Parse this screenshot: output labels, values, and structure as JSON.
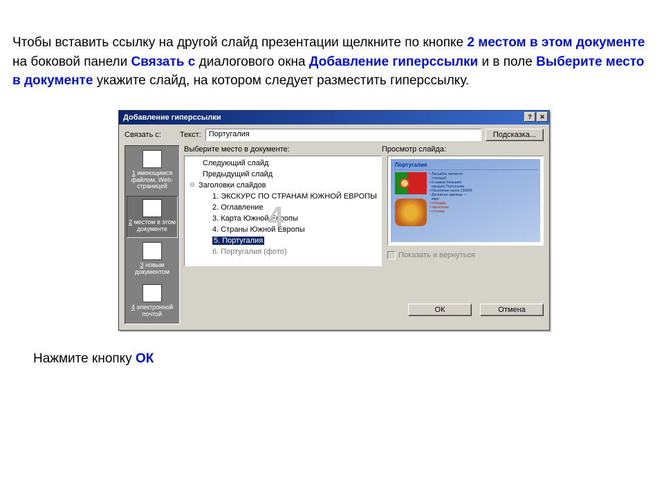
{
  "instr": {
    "t1": "Чтобы вставить ссылку на другой слайд презентации щелкните по кнопке ",
    "h1": "2 местом в этом документе",
    "t2": " на боковой панели ",
    "h2": "Связать с",
    "t3": " диалогового окна ",
    "h3": "Добавление гиперссылки",
    "t4": " и в поле ",
    "h4": "Выберите место в документе",
    "t5": " укажите слайд, на котором следует разместить гиперссылку."
  },
  "bottom": {
    "t": "Нажмите кнопку ",
    "ok": "ОК"
  },
  "dlg": {
    "title": "Добавление гиперссылки",
    "linkWith": "Связать с:",
    "textLbl": "Текст:",
    "textVal": "Португалия",
    "hintBtn": "Подсказка...",
    "sidebar": {
      "item1a": "1",
      "item1b": " имеющимся файлом, Web-страницей",
      "item2a": "2",
      "item2b": " местом в этом документе",
      "item3a": "3",
      "item3b": " новым документом",
      "item4a": "4",
      "item4b": " электронной почтой"
    },
    "treeLbl": "Выберите место в документе:",
    "previewLbl": "Просмотр слайда:",
    "over4": "4",
    "tree": {
      "r1": "Следующий слайд",
      "r2": "Предыдущий слайд",
      "r3": "Заголовки слайдов",
      "r4": "1. ЭКСКУРС ПО СТРАНАМ ЮЖНОЙ ЕВРОПЫ",
      "r5": "2. Оглавление",
      "r6": "3. Карта Южной Европы",
      "r7": "4. Страны Южной Европы",
      "r8": "5. Португалия",
      "r9": "6. Португалия (фото)"
    },
    "slideTitle": "Португалия",
    "chk": "Показать и вернуться",
    "ok": "ОК",
    "cancel": "Отмена"
  }
}
